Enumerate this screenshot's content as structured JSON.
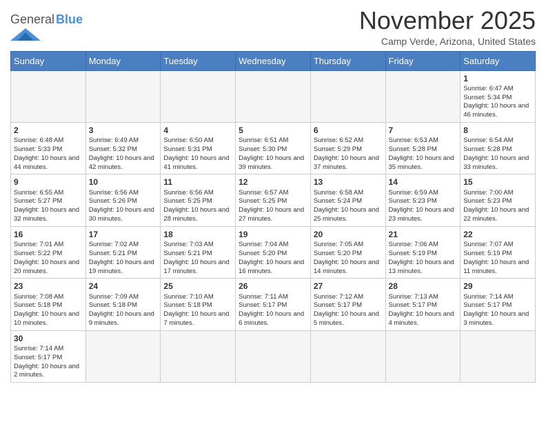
{
  "header": {
    "logo_general": "General",
    "logo_blue": "Blue",
    "month_title": "November 2025",
    "location": "Camp Verde, Arizona, United States"
  },
  "weekdays": [
    "Sunday",
    "Monday",
    "Tuesday",
    "Wednesday",
    "Thursday",
    "Friday",
    "Saturday"
  ],
  "weeks": [
    [
      {
        "day": "",
        "info": ""
      },
      {
        "day": "",
        "info": ""
      },
      {
        "day": "",
        "info": ""
      },
      {
        "day": "",
        "info": ""
      },
      {
        "day": "",
        "info": ""
      },
      {
        "day": "",
        "info": ""
      },
      {
        "day": "1",
        "info": "Sunrise: 6:47 AM\nSunset: 5:34 PM\nDaylight: 10 hours and 46 minutes."
      }
    ],
    [
      {
        "day": "2",
        "info": "Sunrise: 6:48 AM\nSunset: 5:33 PM\nDaylight: 10 hours and 44 minutes."
      },
      {
        "day": "3",
        "info": "Sunrise: 6:49 AM\nSunset: 5:32 PM\nDaylight: 10 hours and 42 minutes."
      },
      {
        "day": "4",
        "info": "Sunrise: 6:50 AM\nSunset: 5:31 PM\nDaylight: 10 hours and 41 minutes."
      },
      {
        "day": "5",
        "info": "Sunrise: 6:51 AM\nSunset: 5:30 PM\nDaylight: 10 hours and 39 minutes."
      },
      {
        "day": "6",
        "info": "Sunrise: 6:52 AM\nSunset: 5:29 PM\nDaylight: 10 hours and 37 minutes."
      },
      {
        "day": "7",
        "info": "Sunrise: 6:53 AM\nSunset: 5:28 PM\nDaylight: 10 hours and 35 minutes."
      },
      {
        "day": "8",
        "info": "Sunrise: 6:54 AM\nSunset: 5:28 PM\nDaylight: 10 hours and 33 minutes."
      }
    ],
    [
      {
        "day": "9",
        "info": "Sunrise: 6:55 AM\nSunset: 5:27 PM\nDaylight: 10 hours and 32 minutes."
      },
      {
        "day": "10",
        "info": "Sunrise: 6:56 AM\nSunset: 5:26 PM\nDaylight: 10 hours and 30 minutes."
      },
      {
        "day": "11",
        "info": "Sunrise: 6:56 AM\nSunset: 5:25 PM\nDaylight: 10 hours and 28 minutes."
      },
      {
        "day": "12",
        "info": "Sunrise: 6:57 AM\nSunset: 5:25 PM\nDaylight: 10 hours and 27 minutes."
      },
      {
        "day": "13",
        "info": "Sunrise: 6:58 AM\nSunset: 5:24 PM\nDaylight: 10 hours and 25 minutes."
      },
      {
        "day": "14",
        "info": "Sunrise: 6:59 AM\nSunset: 5:23 PM\nDaylight: 10 hours and 23 minutes."
      },
      {
        "day": "15",
        "info": "Sunrise: 7:00 AM\nSunset: 5:23 PM\nDaylight: 10 hours and 22 minutes."
      }
    ],
    [
      {
        "day": "16",
        "info": "Sunrise: 7:01 AM\nSunset: 5:22 PM\nDaylight: 10 hours and 20 minutes."
      },
      {
        "day": "17",
        "info": "Sunrise: 7:02 AM\nSunset: 5:21 PM\nDaylight: 10 hours and 19 minutes."
      },
      {
        "day": "18",
        "info": "Sunrise: 7:03 AM\nSunset: 5:21 PM\nDaylight: 10 hours and 17 minutes."
      },
      {
        "day": "19",
        "info": "Sunrise: 7:04 AM\nSunset: 5:20 PM\nDaylight: 10 hours and 16 minutes."
      },
      {
        "day": "20",
        "info": "Sunrise: 7:05 AM\nSunset: 5:20 PM\nDaylight: 10 hours and 14 minutes."
      },
      {
        "day": "21",
        "info": "Sunrise: 7:06 AM\nSunset: 5:19 PM\nDaylight: 10 hours and 13 minutes."
      },
      {
        "day": "22",
        "info": "Sunrise: 7:07 AM\nSunset: 5:19 PM\nDaylight: 10 hours and 11 minutes."
      }
    ],
    [
      {
        "day": "23",
        "info": "Sunrise: 7:08 AM\nSunset: 5:18 PM\nDaylight: 10 hours and 10 minutes."
      },
      {
        "day": "24",
        "info": "Sunrise: 7:09 AM\nSunset: 5:18 PM\nDaylight: 10 hours and 9 minutes."
      },
      {
        "day": "25",
        "info": "Sunrise: 7:10 AM\nSunset: 5:18 PM\nDaylight: 10 hours and 7 minutes."
      },
      {
        "day": "26",
        "info": "Sunrise: 7:11 AM\nSunset: 5:17 PM\nDaylight: 10 hours and 6 minutes."
      },
      {
        "day": "27",
        "info": "Sunrise: 7:12 AM\nSunset: 5:17 PM\nDaylight: 10 hours and 5 minutes."
      },
      {
        "day": "28",
        "info": "Sunrise: 7:13 AM\nSunset: 5:17 PM\nDaylight: 10 hours and 4 minutes."
      },
      {
        "day": "29",
        "info": "Sunrise: 7:14 AM\nSunset: 5:17 PM\nDaylight: 10 hours and 3 minutes."
      }
    ],
    [
      {
        "day": "30",
        "info": "Sunrise: 7:14 AM\nSunset: 5:17 PM\nDaylight: 10 hours and 2 minutes."
      },
      {
        "day": "",
        "info": ""
      },
      {
        "day": "",
        "info": ""
      },
      {
        "day": "",
        "info": ""
      },
      {
        "day": "",
        "info": ""
      },
      {
        "day": "",
        "info": ""
      },
      {
        "day": "",
        "info": ""
      }
    ]
  ]
}
